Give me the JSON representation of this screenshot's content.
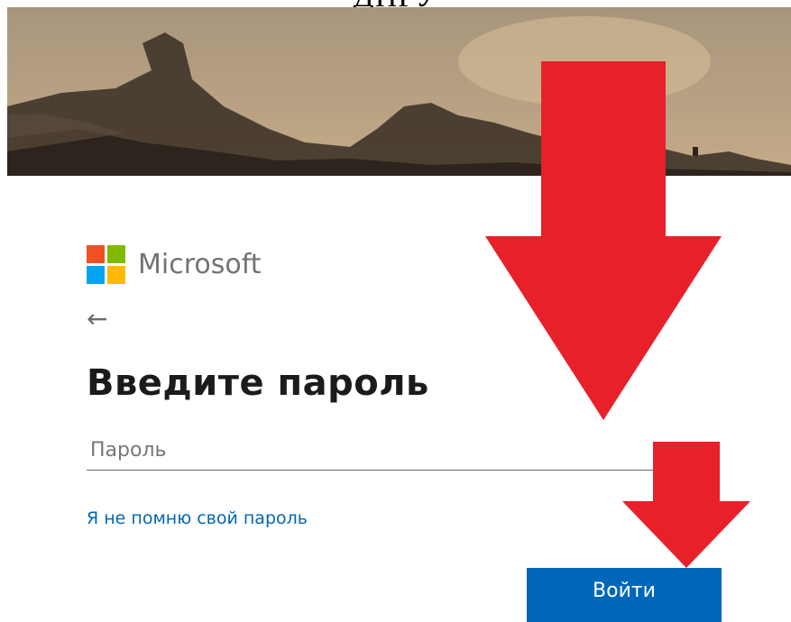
{
  "caption": {
    "text": "ДПРУ"
  },
  "brand": {
    "name": "Microsoft",
    "logo_colors": [
      "#f25022",
      "#7fba00",
      "#00a4ef",
      "#ffb900"
    ]
  },
  "signin": {
    "back_icon": "back-arrow-icon",
    "heading": "Введите пароль",
    "password_placeholder": "Пароль",
    "password_value": "",
    "forgot_link": "Я не помню свой пароль",
    "submit_label": "Войти"
  },
  "colors": {
    "accent": "#0067b8",
    "annotation_arrow": "#e8202a"
  }
}
